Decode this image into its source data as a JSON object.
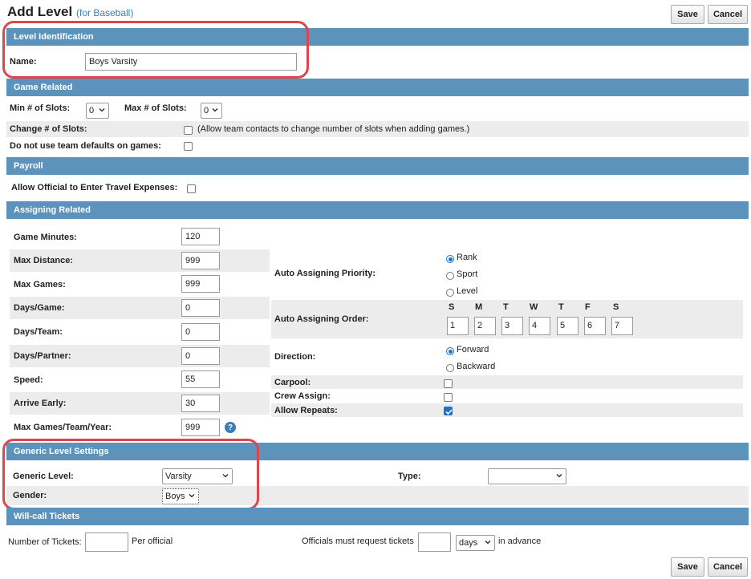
{
  "header": {
    "title": "Add Level",
    "subtitle": "(for Baseball)",
    "save_label": "Save",
    "cancel_label": "Cancel"
  },
  "level_identification": {
    "section_title": "Level Identification",
    "name_label": "Name:",
    "name_value": "Boys Varsity"
  },
  "game_related": {
    "section_title": "Game Related",
    "min_slots_label": "Min # of Slots:",
    "min_slots_value": "0",
    "max_slots_label": "Max # of Slots:",
    "max_slots_value": "0",
    "change_slots_label": "Change # of Slots:",
    "change_slots_note": "(Allow team contacts to change number of slots when adding games.)",
    "change_slots_checked": false,
    "no_team_defaults_label": "Do not use team defaults on games:",
    "no_team_defaults_checked": false
  },
  "payroll": {
    "section_title": "Payroll",
    "travel_expenses_label": "Allow Official to Enter Travel Expenses:",
    "travel_expenses_checked": false
  },
  "assigning": {
    "section_title": "Assigning Related",
    "game_minutes_label": "Game Minutes:",
    "game_minutes_value": "120",
    "max_distance_label": "Max Distance:",
    "max_distance_value": "999",
    "max_games_label": "Max Games:",
    "max_games_value": "999",
    "days_game_label": "Days/Game:",
    "days_game_value": "0",
    "days_team_label": "Days/Team:",
    "days_team_value": "0",
    "days_partner_label": "Days/Partner:",
    "days_partner_value": "0",
    "speed_label": "Speed:",
    "speed_value": "55",
    "arrive_early_label": "Arrive Early:",
    "arrive_early_value": "30",
    "max_games_team_year_label": "Max Games/Team/Year:",
    "max_games_team_year_value": "999",
    "help_glyph": "?",
    "priority_label": "Auto Assigning Priority:",
    "priority_options": [
      "Rank",
      "Sport",
      "Level"
    ],
    "priority_selected": "Rank",
    "order_label": "Auto Assigning Order:",
    "order_days": [
      "S",
      "M",
      "T",
      "W",
      "T",
      "F",
      "S"
    ],
    "order_values": [
      "1",
      "2",
      "3",
      "4",
      "5",
      "6",
      "7"
    ],
    "direction_label": "Direction:",
    "direction_options": [
      "Forward",
      "Backward"
    ],
    "direction_selected": "Forward",
    "carpool_label": "Carpool:",
    "carpool_checked": false,
    "crew_assign_label": "Crew Assign:",
    "crew_assign_checked": false,
    "allow_repeats_label": "Allow Repeats:",
    "allow_repeats_checked": true
  },
  "generic": {
    "section_title": "Generic Level Settings",
    "generic_level_label": "Generic Level:",
    "generic_level_value": "Varsity",
    "type_label": "Type:",
    "type_value": "",
    "gender_label": "Gender:",
    "gender_value": "Boys"
  },
  "will_call": {
    "section_title": "Will-call Tickets",
    "number_label": "Number of Tickets:",
    "number_value": "",
    "per_official": "Per official",
    "must_request_label": "Officials must request tickets",
    "request_value": "",
    "unit_value": "days",
    "in_advance": "in advance"
  },
  "colors": {
    "section_bar": "#5b93bd",
    "highlight": "#e0444f",
    "accent": "#1a73c8"
  }
}
